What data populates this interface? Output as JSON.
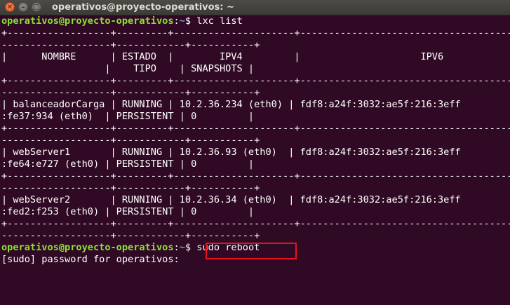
{
  "window": {
    "title": "operativos@proyecto-operativos: ~",
    "close_glyph": "✕",
    "minimize_glyph": "–",
    "maximize_glyph": "□"
  },
  "terminal": {
    "prompt1": {
      "user_host": "operativos@proyecto-operativos",
      "sep": ":",
      "path": "~",
      "sigil": "$ ",
      "command": "lxc list"
    },
    "table_lines": [
      "+------------------+---------+---------------------+----------------------------------------------",
      "-------------------+------------+-----------+",
      "|      NOMBRE      | ESTADO  |        IPV4         |                     IPV6",
      "                  |    TIPO    | SNAPSHOTS |",
      "+------------------+---------+---------------------+----------------------------------------------",
      "-------------------+------------+-----------+",
      "| balanceadorCarga | RUNNING | 10.2.36.234 (eth0) | fdf8:a24f:3032:ae5f:216:3eff",
      ":fe37:934 (eth0)  | PERSISTENT | 0         |",
      "+------------------+---------+---------------------+----------------------------------------------",
      "-------------------+------------+-----------+",
      "| webServer1       | RUNNING | 10.2.36.93 (eth0)  | fdf8:a24f:3032:ae5f:216:3eff",
      ":fe64:e727 (eth0) | PERSISTENT | 0         |",
      "+------------------+---------+---------------------+----------------------------------------------",
      "-------------------+------------+-----------+",
      "| webServer2       | RUNNING | 10.2.36.34 (eth0)  | fdf8:a24f:3032:ae5f:216:3eff",
      ":fed2:f253 (eth0) | PERSISTENT | 0         |",
      "+------------------+---------+---------------------+----------------------------------------------",
      "-------------------+------------+-----------+"
    ],
    "prompt2": {
      "user_host": "operativos@proyecto-operativos",
      "sep": ":",
      "path": "~",
      "sigil": "$ ",
      "command": "sudo reboot"
    },
    "sudo_prompt": "[sudo] password for operativos: "
  },
  "colors": {
    "background": "#300a24",
    "prompt_user": "#8ae234",
    "prompt_path": "#729fcf",
    "highlight": "#e8141a"
  }
}
